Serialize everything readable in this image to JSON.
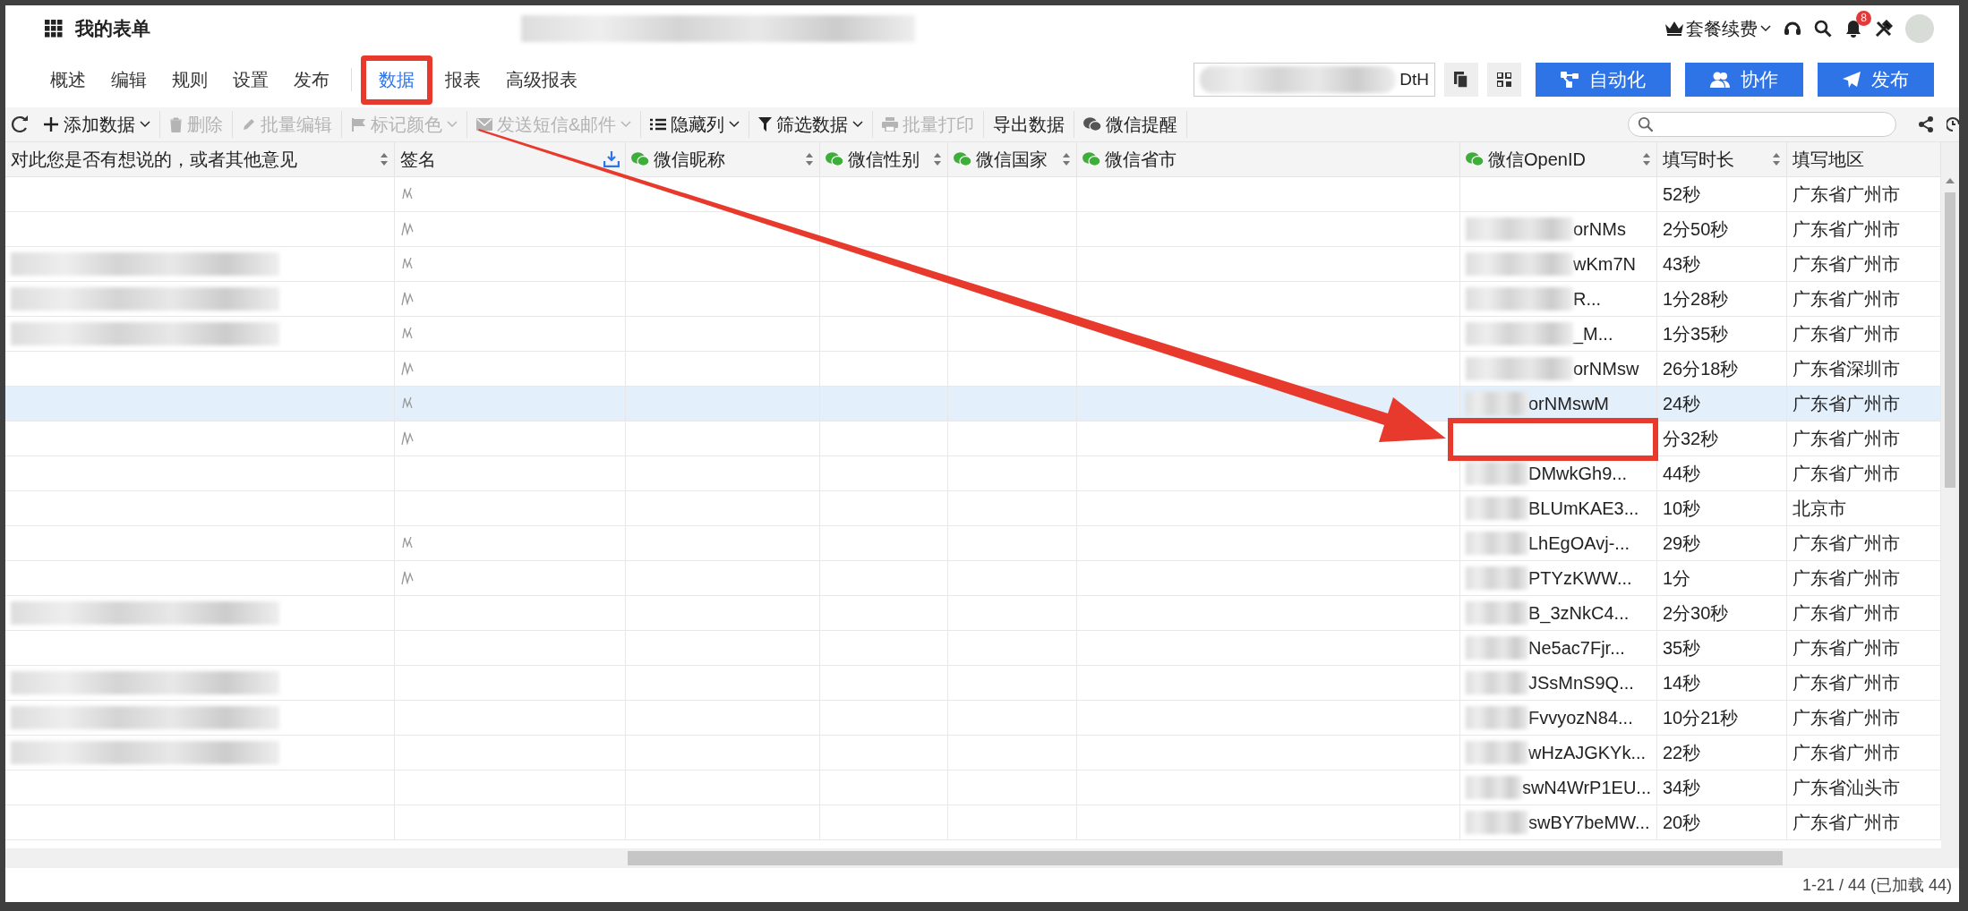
{
  "header": {
    "title": "我的表单",
    "renew_label": "套餐续费",
    "notification_count": "8"
  },
  "nav_groups": [
    [
      {
        "label": "概述",
        "selected": false
      },
      {
        "label": "编辑",
        "selected": false
      },
      {
        "label": "规则",
        "selected": false
      },
      {
        "label": "设置",
        "selected": false
      },
      {
        "label": "发布",
        "selected": false
      }
    ],
    [
      {
        "label": "数据",
        "selected": true,
        "annotated": true
      },
      {
        "label": "报表",
        "selected": false,
        "annotated": false
      },
      {
        "label": "高级报表",
        "selected": false,
        "annotated": false
      }
    ]
  ],
  "link_field": {
    "value": "DtH"
  },
  "action_buttons": [
    {
      "label": "自动化",
      "kind": "flow"
    },
    {
      "label": "协作",
      "kind": "people"
    },
    {
      "label": "发布",
      "kind": "send"
    }
  ],
  "toolbar": [
    {
      "label": "添加数据",
      "kind": "plus",
      "dropdown": true,
      "disabled": false
    },
    {
      "label": "删除",
      "kind": "trash",
      "dropdown": false,
      "disabled": true
    },
    {
      "label": "批量编辑",
      "kind": "pencil",
      "dropdown": false,
      "disabled": true
    },
    {
      "label": "标记颜色",
      "kind": "flag",
      "dropdown": true,
      "disabled": true
    },
    {
      "label": "发送短信&邮件",
      "kind": "envelope",
      "dropdown": true,
      "disabled": true
    },
    {
      "label": "隐藏列",
      "kind": "list",
      "dropdown": true,
      "disabled": false
    },
    {
      "label": "筛选数据",
      "kind": "filter",
      "dropdown": true,
      "disabled": false
    },
    {
      "label": "批量打印",
      "kind": "printer",
      "dropdown": false,
      "disabled": true
    },
    {
      "label": "导出数据",
      "kind": "text",
      "dropdown": false,
      "disabled": false
    },
    {
      "label": "微信提醒",
      "kind": "wechat",
      "dropdown": false,
      "disabled": false
    }
  ],
  "columns": [
    {
      "label": "对此您是否有想说的，或者其他意见",
      "kind": "text",
      "sortable": true
    },
    {
      "label": "签名",
      "kind": "download",
      "sortable": false
    },
    {
      "label": "微信昵称",
      "kind": "wechat",
      "sortable": true
    },
    {
      "label": "微信性别",
      "kind": "wechat",
      "sortable": true
    },
    {
      "label": "微信国家",
      "kind": "wechat",
      "sortable": true
    },
    {
      "label": "微信省市",
      "kind": "wechat",
      "sortable": false
    },
    {
      "label": "微信OpenID",
      "kind": "wechat",
      "sortable": true
    },
    {
      "label": "填写时长",
      "kind": "text",
      "sortable": true
    },
    {
      "label": "填写地区",
      "kind": "text",
      "sortable": false
    }
  ],
  "rows": [
    {
      "comment_redacted": false,
      "signature": true,
      "duration": "52秒",
      "region": "广东省广州市",
      "selected": false,
      "annotated": false
    },
    {
      "comment_redacted": false,
      "signature": true,
      "openid": "orNMs",
      "duration": "2分50秒",
      "region": "广东省广州市",
      "selected": false,
      "annotated": false
    },
    {
      "comment_redacted": true,
      "signature": true,
      "openid": "wKm7N",
      "duration": "43秒",
      "region": "广东省广州市",
      "selected": false,
      "annotated": false
    },
    {
      "comment_redacted": true,
      "signature": true,
      "openid": "R...",
      "duration": "1分28秒",
      "region": "广东省广州市",
      "selected": false,
      "annotated": false
    },
    {
      "comment_redacted": true,
      "signature": true,
      "openid": "_M...",
      "duration": "1分35秒",
      "region": "广东省广州市",
      "selected": false,
      "annotated": false
    },
    {
      "comment_redacted": false,
      "signature": true,
      "openid": "orNMsw",
      "duration": "26分18秒",
      "region": "广东省深圳市",
      "selected": false,
      "annotated": false
    },
    {
      "comment_redacted": false,
      "signature": true,
      "openid": "orNMswM",
      "duration": "24秒",
      "region": "广东省广州市",
      "selected": true,
      "annotated": false
    },
    {
      "comment_redacted": false,
      "signature": true,
      "duration": "分32秒",
      "region": "广东省广州市",
      "selected": false,
      "annotated": true
    },
    {
      "comment_redacted": false,
      "signature": false,
      "openid": "DMwkGh9...",
      "duration": "44秒",
      "region": "广东省广州市",
      "selected": false,
      "annotated": false
    },
    {
      "comment_redacted": false,
      "signature": false,
      "openid": "BLUmKAE3...",
      "duration": "10秒",
      "region": "北京市",
      "selected": false,
      "annotated": false
    },
    {
      "comment_redacted": false,
      "signature": true,
      "openid": "LhEgOAvj-...",
      "duration": "29秒",
      "region": "广东省广州市",
      "selected": false,
      "annotated": false
    },
    {
      "comment_redacted": false,
      "signature": true,
      "openid": "PTYzKWW...",
      "duration": "1分",
      "region": "广东省广州市",
      "selected": false,
      "annotated": false
    },
    {
      "comment_redacted": true,
      "signature": false,
      "openid": "B_3zNkC4...",
      "duration": "2分30秒",
      "region": "广东省广州市",
      "selected": false,
      "annotated": false
    },
    {
      "comment_redacted": false,
      "signature": false,
      "openid": "Ne5ac7Fjr...",
      "duration": "35秒",
      "region": "广东省广州市",
      "selected": false,
      "annotated": false
    },
    {
      "comment_redacted": true,
      "signature": false,
      "openid": "JSsMnS9Q...",
      "duration": "14秒",
      "region": "广东省广州市",
      "selected": false,
      "annotated": false
    },
    {
      "comment_redacted": true,
      "signature": false,
      "openid": "FvvyozN84...",
      "duration": "10分21秒",
      "region": "广东省广州市",
      "selected": false,
      "annotated": false
    },
    {
      "comment_redacted": true,
      "signature": false,
      "openid": "wHzAJGKYk...",
      "duration": "22秒",
      "region": "广东省广州市",
      "selected": false,
      "annotated": false
    },
    {
      "comment_redacted": false,
      "signature": false,
      "openid": "swN4WrP1EU...",
      "duration": "34秒",
      "region": "广东省汕头市",
      "selected": false,
      "annotated": false
    },
    {
      "comment_redacted": false,
      "signature": false,
      "openid": "swBY7beMW...",
      "duration": "20秒",
      "region": "广东省广州市",
      "selected": false,
      "annotated": false
    }
  ],
  "status": "1-21 / 44 (已加载 44)"
}
